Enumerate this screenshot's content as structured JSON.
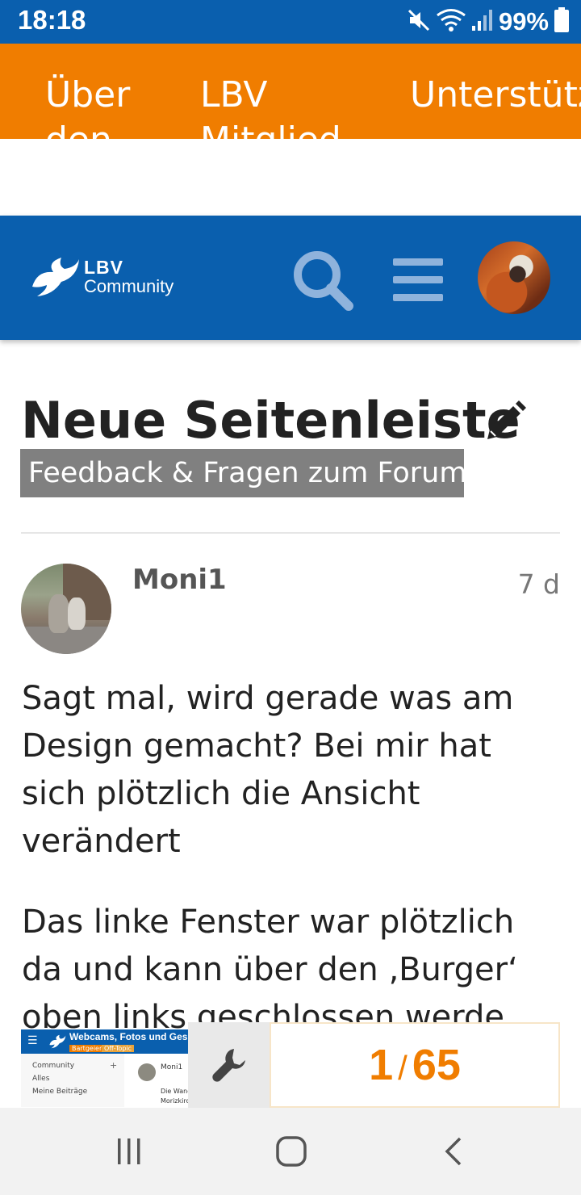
{
  "status_bar": {
    "time": "18:18",
    "battery_percent": "99%",
    "icons": [
      "mute-icon",
      "wifi-icon",
      "signal-icon",
      "battery-icon"
    ]
  },
  "site_nav": {
    "items": [
      {
        "label": "Über den"
      },
      {
        "label": "LBV Mitglied"
      },
      {
        "label": "Unterstützen"
      }
    ]
  },
  "header": {
    "logo_line1": "LBV",
    "logo_line2": "Community",
    "icons": [
      "search-icon",
      "menu-icon",
      "user-avatar"
    ]
  },
  "topic": {
    "title": "Neue Seitenleiste",
    "category": "Feedback & Fragen zum Forum"
  },
  "post": {
    "author": "Moni1",
    "date": "7 d",
    "paragraphs": [
      "Sagt mal, wird gerade was am Design gemacht? Bei mir hat sich plötzlich die Ansicht verändert",
      "Das linke Fenster war plötzlich da und kann über den ‚Burger‘ oben links geschlossen werde."
    ]
  },
  "preview": {
    "title": "Webcams, Fotos und Ges",
    "tag1": "Bartgeier",
    "tag2": "Off-Topic",
    "sidebar": [
      "Community",
      "Alles",
      "Meine Beiträge"
    ],
    "post_author": "Moni1",
    "post_lines": [
      "Die Wand",
      "Morizkirch"
    ]
  },
  "progress": {
    "current": "1",
    "separator": "/",
    "total": "65"
  },
  "colors": {
    "brand_blue": "#0a5fae",
    "brand_orange": "#f07d00",
    "category_gray": "#808080"
  }
}
